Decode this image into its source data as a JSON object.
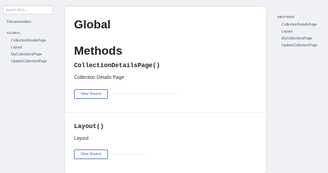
{
  "sidebar": {
    "search_placeholder": "Search docs...",
    "documentation": "Documentation",
    "global_heading": "GLOBAL",
    "items": [
      {
        "label": "CollectionDetailsPage"
      },
      {
        "label": "Layout"
      },
      {
        "label": "MyCollectionsPage"
      },
      {
        "label": "UpdateCollectionPage"
      }
    ]
  },
  "main": {
    "title": "Global",
    "methods_heading": "Methods",
    "methods": [
      {
        "signature": "CollectionDetailsPage()",
        "description": "Collection Details Page",
        "button_label": "View Source",
        "source_note": "pages/collection-details-page/index.tsx, line 3"
      },
      {
        "signature": "Layout()",
        "description": "Layout",
        "button_label": "View Source",
        "source_note": "layout/index.tsx, line 8"
      }
    ]
  },
  "toc": {
    "heading": "METHODS",
    "items": [
      {
        "label": "CollectionDetailsPage"
      },
      {
        "label": "Layout"
      },
      {
        "label": "MyCollectionsPage"
      },
      {
        "label": "UpdateCollectionPage"
      }
    ]
  }
}
